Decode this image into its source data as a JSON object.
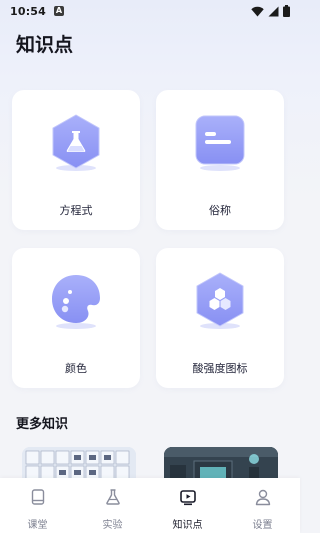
{
  "status_bar": {
    "time": "10:54",
    "notification_badge": "A"
  },
  "page": {
    "title": "知识点"
  },
  "cards": [
    {
      "label": "方程式",
      "icon": "flask-hexagon-icon"
    },
    {
      "label": "俗称",
      "icon": "document-lines-icon"
    },
    {
      "label": "颜色",
      "icon": "palette-icon"
    },
    {
      "label": "酸强度图标",
      "icon": "hexagon-cluster-icon"
    }
  ],
  "more": {
    "title": "更多知识"
  },
  "tabs": [
    {
      "label": "课堂",
      "icon": "book-icon",
      "active": false
    },
    {
      "label": "实验",
      "icon": "flask-icon",
      "active": false
    },
    {
      "label": "知识点",
      "icon": "play-screen-icon",
      "active": true
    },
    {
      "label": "设置",
      "icon": "user-icon",
      "active": false
    }
  ],
  "colors": {
    "accent": "#8c95f6",
    "accent_light": "#b4bbfa",
    "background": "#f3f4f8"
  }
}
